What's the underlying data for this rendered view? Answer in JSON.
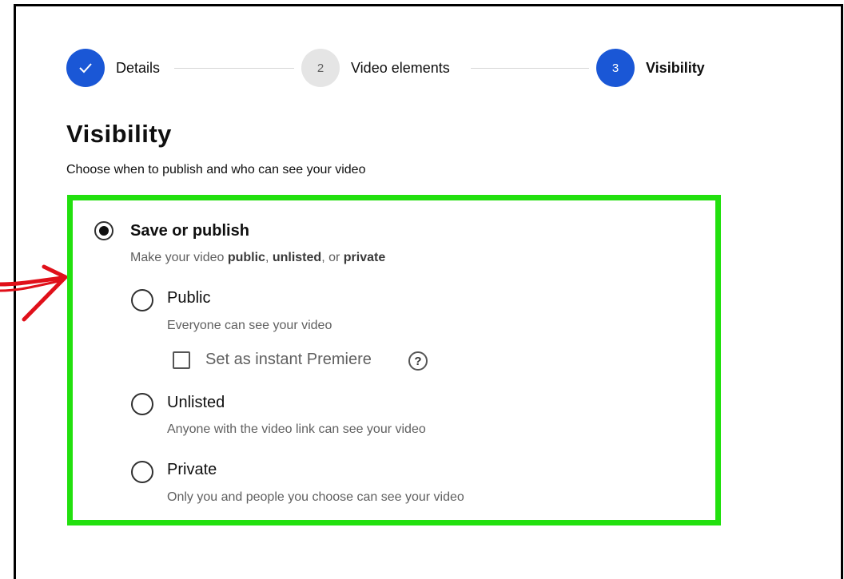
{
  "stepper": {
    "steps": [
      {
        "number": "✓",
        "label": "Details",
        "state": "completed"
      },
      {
        "number": "2",
        "label": "Video elements",
        "state": "upcoming"
      },
      {
        "number": "3",
        "label": "Visibility",
        "state": "active"
      }
    ]
  },
  "page": {
    "title": "Visibility",
    "subtitle": "Choose when to publish and who can see your video"
  },
  "save_or_publish": {
    "label": "Save or publish",
    "selected": true,
    "desc_prefix": "Make your video ",
    "desc_public": "public",
    "desc_sep1": ", ",
    "desc_unlisted": "unlisted",
    "desc_sep2": ", or ",
    "desc_private": "private"
  },
  "options": {
    "public": {
      "label": "Public",
      "desc": "Everyone can see your video",
      "selected": false
    },
    "premiere": {
      "label": "Set as instant Premiere",
      "checked": false,
      "help_glyph": "?"
    },
    "unlisted": {
      "label": "Unlisted",
      "desc": "Anyone with the video link can see your video",
      "selected": false
    },
    "private": {
      "label": "Private",
      "desc": "Only you and people you choose can see your video",
      "selected": false
    }
  },
  "colors": {
    "accent": "#1a57d6",
    "highlight_border": "#22e00e",
    "annotation_arrow": "#e0101a"
  }
}
